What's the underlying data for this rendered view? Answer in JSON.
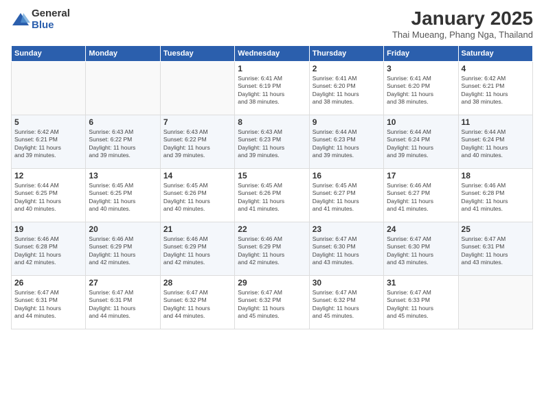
{
  "logo": {
    "general": "General",
    "blue": "Blue"
  },
  "title": "January 2025",
  "location": "Thai Mueang, Phang Nga, Thailand",
  "headers": [
    "Sunday",
    "Monday",
    "Tuesday",
    "Wednesday",
    "Thursday",
    "Friday",
    "Saturday"
  ],
  "weeks": [
    [
      {
        "day": "",
        "info": ""
      },
      {
        "day": "",
        "info": ""
      },
      {
        "day": "",
        "info": ""
      },
      {
        "day": "1",
        "info": "Sunrise: 6:41 AM\nSunset: 6:19 PM\nDaylight: 11 hours\nand 38 minutes."
      },
      {
        "day": "2",
        "info": "Sunrise: 6:41 AM\nSunset: 6:20 PM\nDaylight: 11 hours\nand 38 minutes."
      },
      {
        "day": "3",
        "info": "Sunrise: 6:41 AM\nSunset: 6:20 PM\nDaylight: 11 hours\nand 38 minutes."
      },
      {
        "day": "4",
        "info": "Sunrise: 6:42 AM\nSunset: 6:21 PM\nDaylight: 11 hours\nand 38 minutes."
      }
    ],
    [
      {
        "day": "5",
        "info": "Sunrise: 6:42 AM\nSunset: 6:21 PM\nDaylight: 11 hours\nand 39 minutes."
      },
      {
        "day": "6",
        "info": "Sunrise: 6:43 AM\nSunset: 6:22 PM\nDaylight: 11 hours\nand 39 minutes."
      },
      {
        "day": "7",
        "info": "Sunrise: 6:43 AM\nSunset: 6:22 PM\nDaylight: 11 hours\nand 39 minutes."
      },
      {
        "day": "8",
        "info": "Sunrise: 6:43 AM\nSunset: 6:23 PM\nDaylight: 11 hours\nand 39 minutes."
      },
      {
        "day": "9",
        "info": "Sunrise: 6:44 AM\nSunset: 6:23 PM\nDaylight: 11 hours\nand 39 minutes."
      },
      {
        "day": "10",
        "info": "Sunrise: 6:44 AM\nSunset: 6:24 PM\nDaylight: 11 hours\nand 39 minutes."
      },
      {
        "day": "11",
        "info": "Sunrise: 6:44 AM\nSunset: 6:24 PM\nDaylight: 11 hours\nand 40 minutes."
      }
    ],
    [
      {
        "day": "12",
        "info": "Sunrise: 6:44 AM\nSunset: 6:25 PM\nDaylight: 11 hours\nand 40 minutes."
      },
      {
        "day": "13",
        "info": "Sunrise: 6:45 AM\nSunset: 6:25 PM\nDaylight: 11 hours\nand 40 minutes."
      },
      {
        "day": "14",
        "info": "Sunrise: 6:45 AM\nSunset: 6:26 PM\nDaylight: 11 hours\nand 40 minutes."
      },
      {
        "day": "15",
        "info": "Sunrise: 6:45 AM\nSunset: 6:26 PM\nDaylight: 11 hours\nand 41 minutes."
      },
      {
        "day": "16",
        "info": "Sunrise: 6:45 AM\nSunset: 6:27 PM\nDaylight: 11 hours\nand 41 minutes."
      },
      {
        "day": "17",
        "info": "Sunrise: 6:46 AM\nSunset: 6:27 PM\nDaylight: 11 hours\nand 41 minutes."
      },
      {
        "day": "18",
        "info": "Sunrise: 6:46 AM\nSunset: 6:28 PM\nDaylight: 11 hours\nand 41 minutes."
      }
    ],
    [
      {
        "day": "19",
        "info": "Sunrise: 6:46 AM\nSunset: 6:28 PM\nDaylight: 11 hours\nand 42 minutes."
      },
      {
        "day": "20",
        "info": "Sunrise: 6:46 AM\nSunset: 6:29 PM\nDaylight: 11 hours\nand 42 minutes."
      },
      {
        "day": "21",
        "info": "Sunrise: 6:46 AM\nSunset: 6:29 PM\nDaylight: 11 hours\nand 42 minutes."
      },
      {
        "day": "22",
        "info": "Sunrise: 6:46 AM\nSunset: 6:29 PM\nDaylight: 11 hours\nand 42 minutes."
      },
      {
        "day": "23",
        "info": "Sunrise: 6:47 AM\nSunset: 6:30 PM\nDaylight: 11 hours\nand 43 minutes."
      },
      {
        "day": "24",
        "info": "Sunrise: 6:47 AM\nSunset: 6:30 PM\nDaylight: 11 hours\nand 43 minutes."
      },
      {
        "day": "25",
        "info": "Sunrise: 6:47 AM\nSunset: 6:31 PM\nDaylight: 11 hours\nand 43 minutes."
      }
    ],
    [
      {
        "day": "26",
        "info": "Sunrise: 6:47 AM\nSunset: 6:31 PM\nDaylight: 11 hours\nand 44 minutes."
      },
      {
        "day": "27",
        "info": "Sunrise: 6:47 AM\nSunset: 6:31 PM\nDaylight: 11 hours\nand 44 minutes."
      },
      {
        "day": "28",
        "info": "Sunrise: 6:47 AM\nSunset: 6:32 PM\nDaylight: 11 hours\nand 44 minutes."
      },
      {
        "day": "29",
        "info": "Sunrise: 6:47 AM\nSunset: 6:32 PM\nDaylight: 11 hours\nand 45 minutes."
      },
      {
        "day": "30",
        "info": "Sunrise: 6:47 AM\nSunset: 6:32 PM\nDaylight: 11 hours\nand 45 minutes."
      },
      {
        "day": "31",
        "info": "Sunrise: 6:47 AM\nSunset: 6:33 PM\nDaylight: 11 hours\nand 45 minutes."
      },
      {
        "day": "",
        "info": ""
      }
    ]
  ]
}
